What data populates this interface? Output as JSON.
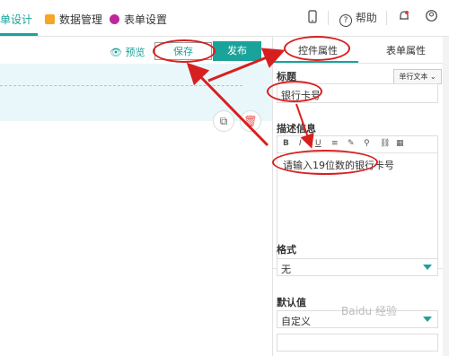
{
  "topbar": {
    "active_tab": "单设计",
    "tabs": [
      "数据管理",
      "表单设置"
    ],
    "help": "帮助"
  },
  "editor": {
    "preview": "预览",
    "save": "保存",
    "publish": "发布"
  },
  "panel": {
    "tab_control": "控件属性",
    "tab_form": "表单属性",
    "title_label": "标题",
    "field_type": "单行文本",
    "title_value": "银行卡号",
    "desc_label": "描述信息",
    "toolbar": [
      "B",
      "I",
      "U",
      "≡",
      "✎",
      "⚲",
      "⛓",
      "▦"
    ],
    "desc_value": "请输入19位数的银行卡号",
    "format_label": "格式",
    "format_value": "无",
    "default_label": "默认值",
    "default_value": "自定义"
  },
  "watermark": "Baidu 经验",
  "colors": {
    "accent": "#1aa39a",
    "annotation": "#d81f1f"
  }
}
